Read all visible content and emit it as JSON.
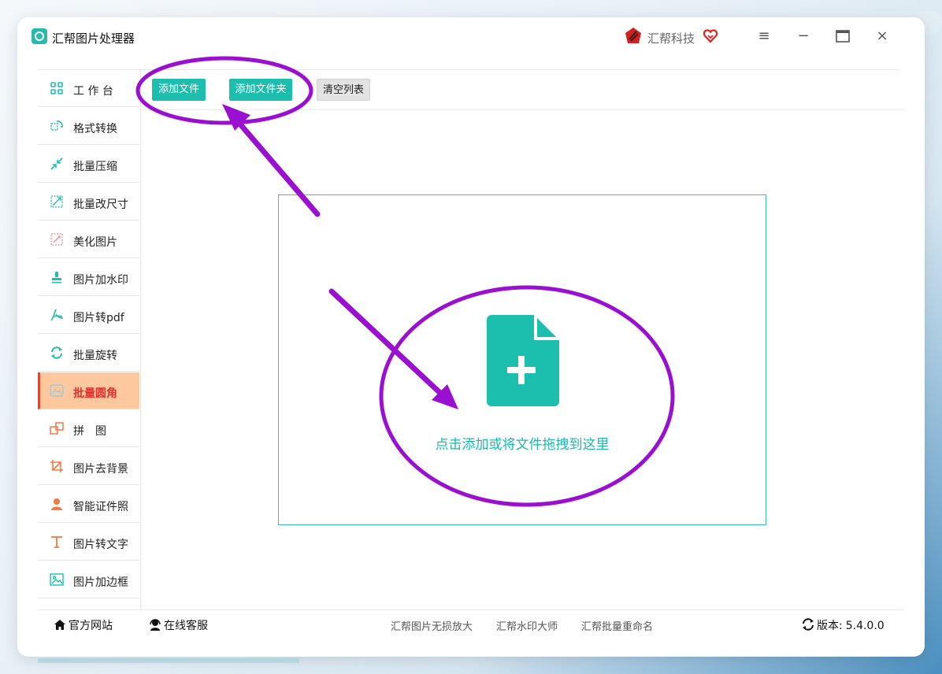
{
  "window": {
    "title": "汇帮图片处理器",
    "brand": "汇帮科技"
  },
  "sidebar": {
    "items": [
      {
        "label": "工 作 台",
        "icon": "grid-icon",
        "color": "#1cbfae"
      },
      {
        "label": "格式转换",
        "icon": "convert-icon",
        "color": "#1cbfae"
      },
      {
        "label": "批量压缩",
        "icon": "compress-icon",
        "color": "#1cbfae"
      },
      {
        "label": "批量改尺寸",
        "icon": "resize-icon",
        "color": "#1cbfae"
      },
      {
        "label": "美化图片",
        "icon": "beautify-icon",
        "color": "#f08a8a"
      },
      {
        "label": "图片加水印",
        "icon": "stamp-icon",
        "color": "#1cbfae"
      },
      {
        "label": "图片转pdf",
        "icon": "pdf-icon",
        "color": "#1cbfae"
      },
      {
        "label": "批量旋转",
        "icon": "rotate-icon",
        "color": "#1cbfae"
      },
      {
        "label": "批量圆角",
        "icon": "round-corner-icon",
        "color": "#9cc8d8"
      },
      {
        "label": "拼　图",
        "icon": "puzzle-icon",
        "color": "#f07a40"
      },
      {
        "label": "图片去背景",
        "icon": "crop-icon",
        "color": "#f07a40"
      },
      {
        "label": "智能证件照",
        "icon": "person-icon",
        "color": "#f07a40"
      },
      {
        "label": "图片转文字",
        "icon": "text-icon",
        "color": "#f07a40"
      },
      {
        "label": "图片加边框",
        "icon": "frame-icon",
        "color": "#1cbfae"
      }
    ],
    "active_index": 8
  },
  "toolbar": {
    "add_file": "添加文件",
    "add_folder": "添加文件夹",
    "clear_list": "清空列表"
  },
  "dropzone": {
    "text": "点击添加或将文件拖拽到这里"
  },
  "footer": {
    "website": "官方网站",
    "support": "在线客服",
    "links": [
      "汇帮图片无损放大",
      "汇帮水印大师",
      "汇帮批量重命名"
    ],
    "version_label": "版本:",
    "version": "5.4.0.0"
  },
  "colors": {
    "accent": "#1cbfae",
    "active_bg": "#fdc89e",
    "active_text": "#e0302d",
    "annotation": "#9a10d0"
  }
}
